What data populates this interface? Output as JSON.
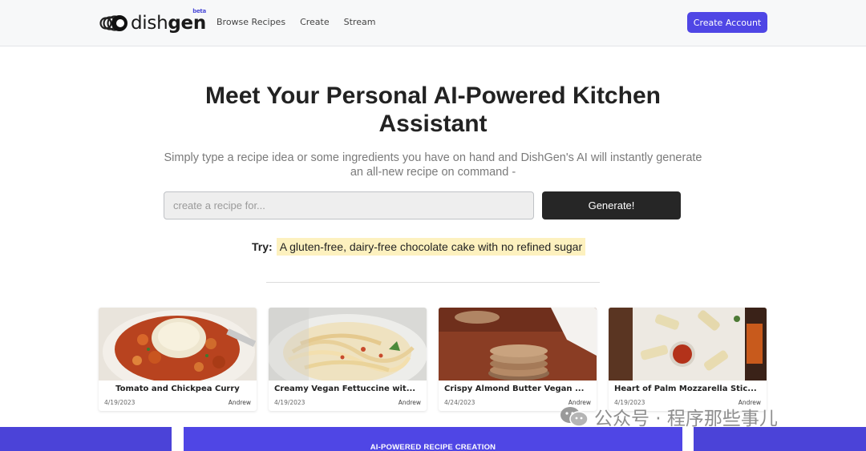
{
  "header": {
    "logo": {
      "text_light": "dish",
      "text_bold": "gen",
      "badge": "beta"
    },
    "nav": [
      {
        "label": "Browse Recipes"
      },
      {
        "label": "Create"
      },
      {
        "label": "Stream"
      }
    ],
    "cta_label": "Create Account",
    "accent": "#4f46e5"
  },
  "hero": {
    "title_line1": "Meet Your Personal AI-Powered Kitchen",
    "title_line2": "Assistant",
    "subtitle_line1": "Simply type a recipe idea or some ingredients you have on hand and DishGen's AI will instantly generate",
    "subtitle_line2": "an all-new recipe on command -",
    "input_placeholder": "create a recipe for...",
    "input_value": "",
    "generate_label": "Generate!",
    "try_label": "Try:",
    "try_suggestion": "A gluten-free, dairy-free chocolate cake with no refined sugar"
  },
  "recipes": [
    {
      "title": "Tomato and Chickpea Curry",
      "date": "4/19/2023",
      "author": "Andrew"
    },
    {
      "title": "Creamy Vegan Fettuccine wit...",
      "date": "4/19/2023",
      "author": "Andrew"
    },
    {
      "title": "Crispy Almond Butter Vegan ...",
      "date": "4/24/2023",
      "author": "Andrew"
    },
    {
      "title": "Heart of Palm Mozzarella Stic...",
      "date": "4/19/2023",
      "author": "Andrew"
    }
  ],
  "band": {
    "label": "AI-POWERED RECIPE CREATION"
  },
  "watermark": {
    "text": "公众号 · 程序那些事儿"
  }
}
